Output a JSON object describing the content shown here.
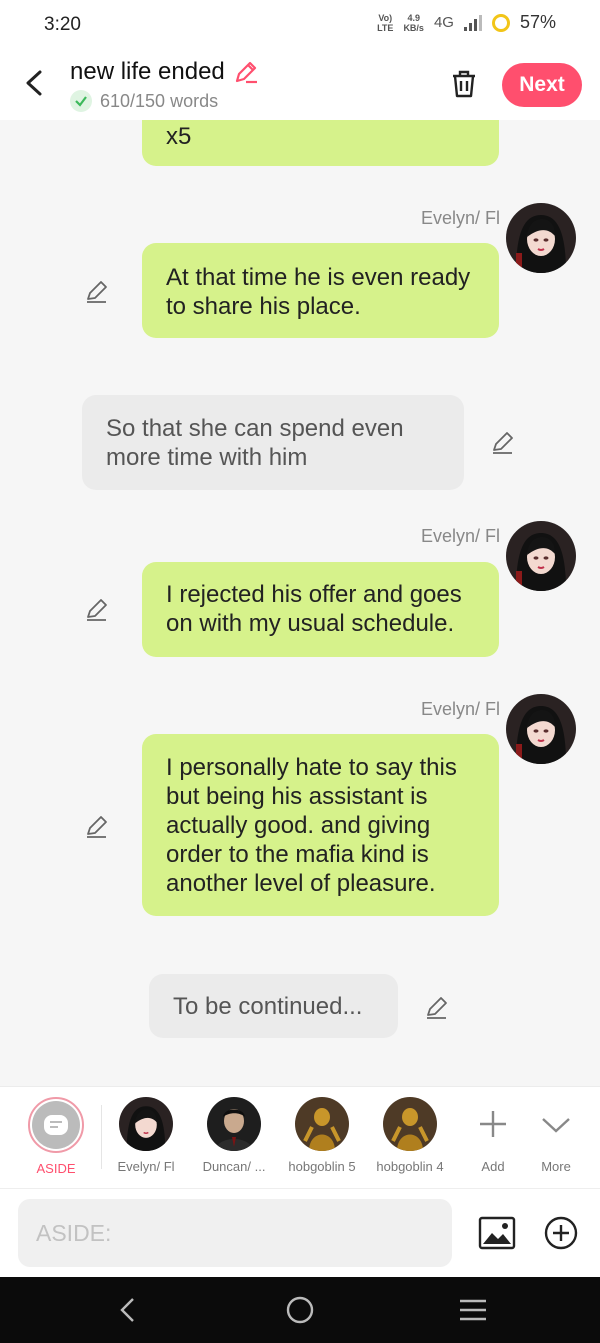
{
  "status": {
    "time": "3:20",
    "volte_top": "Vo)",
    "volte_bottom": "LTE",
    "speed_top": "4.9",
    "speed_bottom": "KB/s",
    "network": "4G",
    "battery": "57%"
  },
  "header": {
    "title": "new life ended",
    "word_count": "610/150 words",
    "next_label": "Next"
  },
  "messages": [
    {
      "type": "right",
      "text": "x5"
    },
    {
      "type": "right",
      "speaker": "Evelyn/ Fl",
      "text": "At that time he is even ready to share his place."
    },
    {
      "type": "aside",
      "text": "So that she can spend even more time with him"
    },
    {
      "type": "right",
      "speaker": "Evelyn/ Fl",
      "text": "I rejected his offer and goes on with my usual schedule."
    },
    {
      "type": "right",
      "speaker": "Evelyn/ Fl",
      "text": "I personally hate to say this but being his assistant is actually good. and giving order to the mafia kind is another level of pleasure."
    },
    {
      "type": "aside",
      "text": "To be continued..."
    }
  ],
  "characters": [
    {
      "label": "ASIDE"
    },
    {
      "label": "Evelyn/ Fl"
    },
    {
      "label": "Duncan/ ..."
    },
    {
      "label": "hobgoblin 5"
    },
    {
      "label": "hobgoblin 4"
    },
    {
      "label": "Add"
    },
    {
      "label": "More"
    }
  ],
  "input": {
    "placeholder": "ASIDE:"
  },
  "colors": {
    "accent": "#ff4f6e",
    "bubble_green": "#d6f28b",
    "aside_gray": "#ebebeb"
  }
}
